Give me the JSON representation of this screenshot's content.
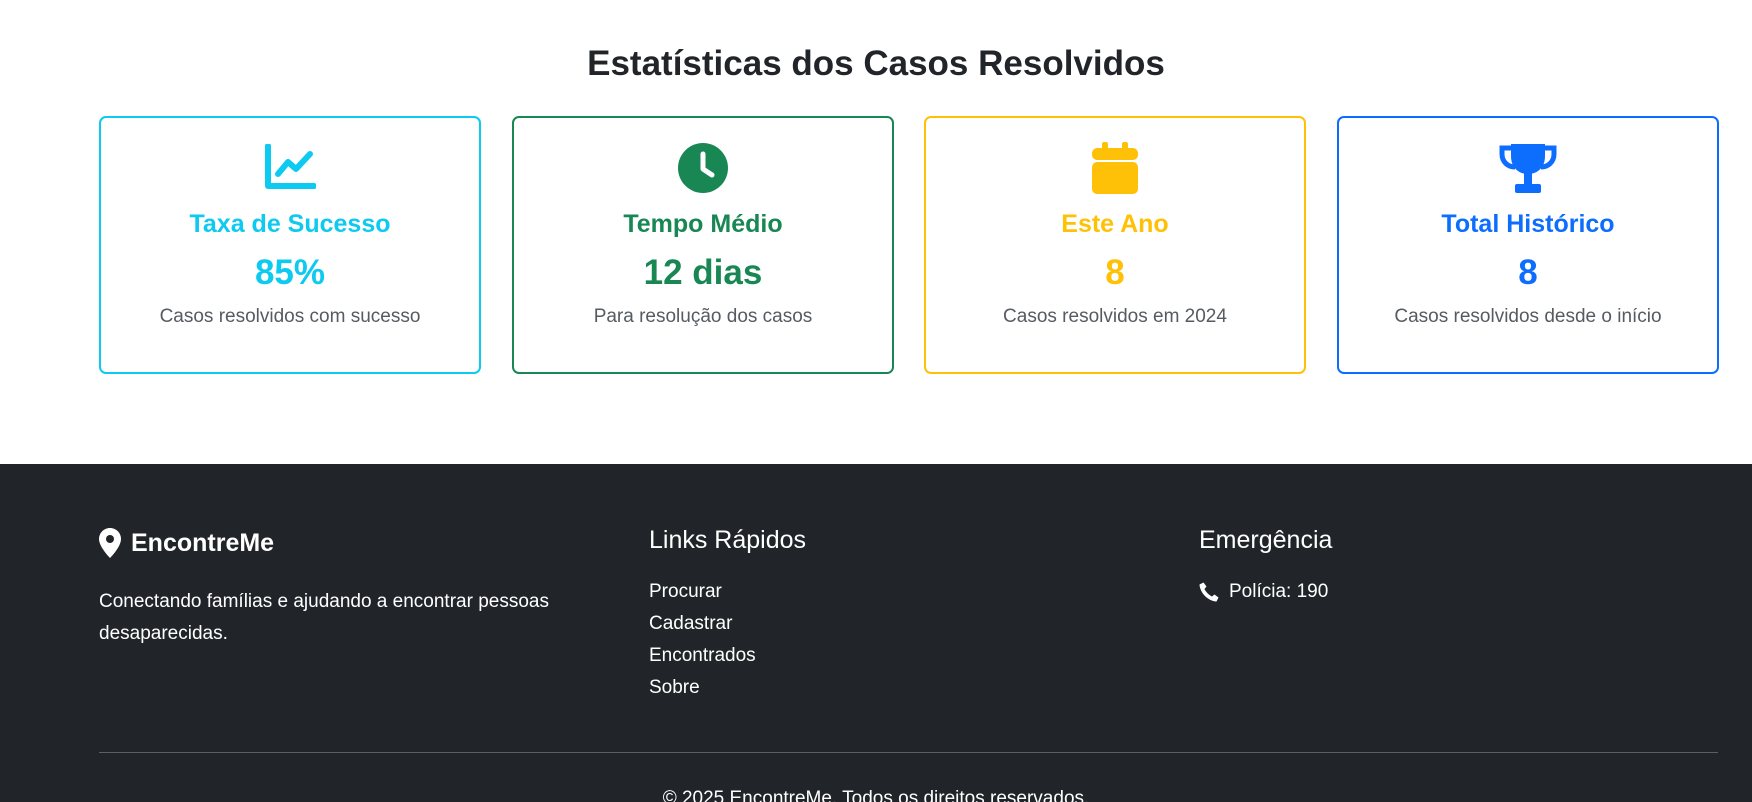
{
  "stats": {
    "title": "Estatísticas dos Casos Resolvidos",
    "cards": [
      {
        "icon": "chart-line-icon",
        "color": "#0dcaf0",
        "title": "Taxa de Sucesso",
        "value": "85%",
        "desc": "Casos resolvidos com sucesso"
      },
      {
        "icon": "clock-icon",
        "color": "#198754",
        "title": "Tempo Médio",
        "value": "12 dias",
        "desc": "Para resolução dos casos"
      },
      {
        "icon": "calendar-icon",
        "color": "#ffc107",
        "title": "Este Ano",
        "value": "8",
        "desc": "Casos resolvidos em 2024"
      },
      {
        "icon": "trophy-icon",
        "color": "#0d6efd",
        "title": "Total Histórico",
        "value": "8",
        "desc": "Casos resolvidos desde o início"
      }
    ]
  },
  "footer": {
    "brand": {
      "icon": "map-pin-icon",
      "name": "EncontreMe",
      "description": "Conectando famílias e ajudando a encontrar pessoas desaparecidas."
    },
    "links": {
      "title": "Links Rápidos",
      "items": [
        "Procurar",
        "Cadastrar",
        "Encontrados",
        "Sobre"
      ]
    },
    "emergency": {
      "title": "Emergência",
      "icon": "phone-icon",
      "items": [
        "Polícia: 190"
      ]
    },
    "copyright": "© 2025 EncontreMe. Todos os direitos reservados."
  }
}
